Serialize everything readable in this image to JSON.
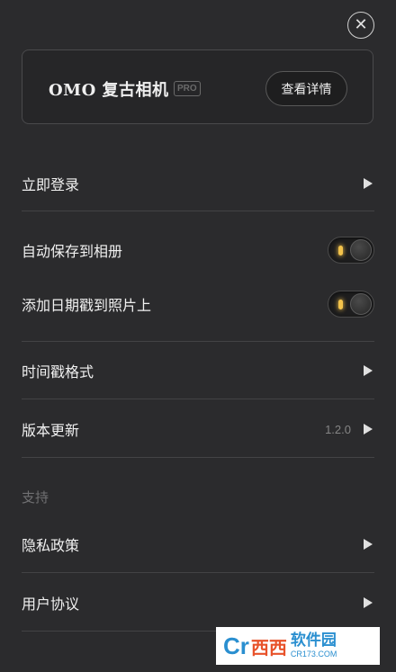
{
  "close_icon": "✕",
  "pro_card": {
    "brand": "OMO 复古相机",
    "badge": "PRO",
    "details_button": "查看详情"
  },
  "menu": {
    "login": "立即登录",
    "auto_save": "自动保存到相册",
    "add_date": "添加日期戳到照片上",
    "timestamp_format": "时间戳格式",
    "version_update": "版本更新",
    "version_value": "1.2.0"
  },
  "toggles": {
    "auto_save_on": true,
    "add_date_on": true,
    "accent_color": "#f2c24b"
  },
  "support_section": {
    "title": "支持",
    "privacy": "隐私政策",
    "user_agreement": "用户协议"
  },
  "watermark": {
    "logo": "Cr",
    "mid": "西西",
    "name": "软件园",
    "url": "CR173.COM"
  }
}
